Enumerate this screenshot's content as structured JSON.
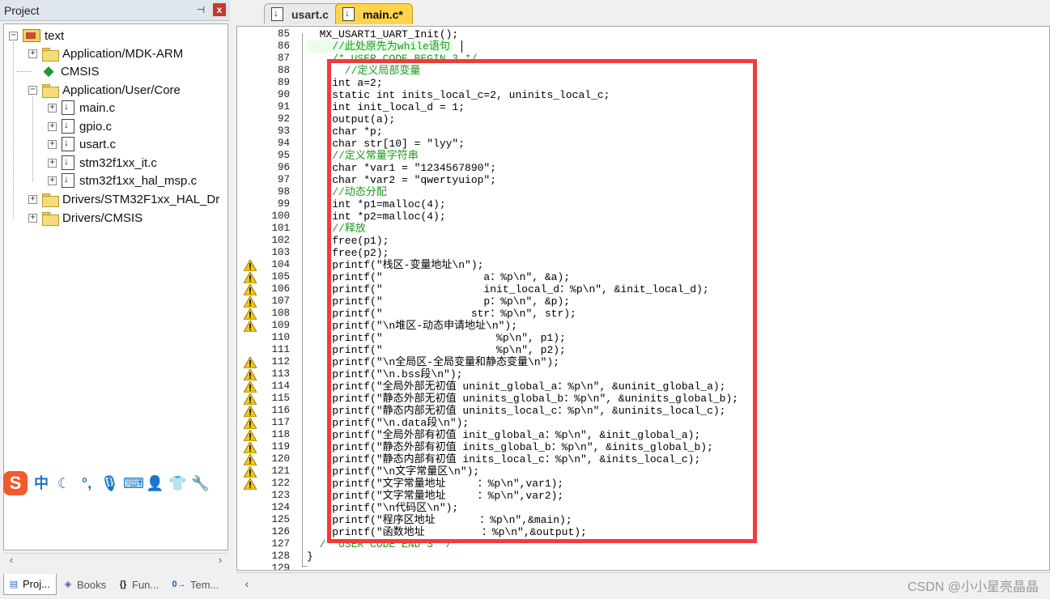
{
  "project_panel": {
    "title": "Project",
    "pin_glyph": "⊣",
    "close_glyph": "x",
    "tree": [
      {
        "label": "text",
        "level": 0,
        "icon": "project-root-icon",
        "expander": "−"
      },
      {
        "label": "Application/MDK-ARM",
        "level": 1,
        "icon": "folder-icon",
        "expander": "+"
      },
      {
        "label": "CMSIS",
        "level": 1,
        "icon": "cmsis-diamond-icon",
        "expander": ""
      },
      {
        "label": "Application/User/Core",
        "level": 1,
        "icon": "folder-icon",
        "expander": "−"
      },
      {
        "label": "main.c",
        "level": 2,
        "icon": "file-icon",
        "expander": "+"
      },
      {
        "label": "gpio.c",
        "level": 2,
        "icon": "file-icon",
        "expander": "+"
      },
      {
        "label": "usart.c",
        "level": 2,
        "icon": "file-icon",
        "expander": "+"
      },
      {
        "label": "stm32f1xx_it.c",
        "level": 2,
        "icon": "file-icon",
        "expander": "+"
      },
      {
        "label": "stm32f1xx_hal_msp.c",
        "level": 2,
        "icon": "file-icon",
        "expander": "+"
      },
      {
        "label": "Drivers/STM32F1xx_HAL_Dr",
        "level": 1,
        "icon": "folder-icon",
        "expander": "+"
      },
      {
        "label": "Drivers/CMSIS",
        "level": 1,
        "icon": "folder-icon",
        "expander": "+"
      }
    ],
    "ime_toolbar": {
      "logo": "S",
      "buttons": [
        "中",
        "☾",
        "°,",
        "🎙",
        "⌨",
        "👤",
        "👕",
        "🔧"
      ]
    },
    "bottom_tabs": [
      {
        "label": "Proj...",
        "icon": "project-tab-icon"
      },
      {
        "label": "Books",
        "icon": "books-tab-icon"
      },
      {
        "label": "Fun...",
        "icon": "functions-tab-icon"
      },
      {
        "label": "Tem...",
        "icon": "templates-tab-icon"
      }
    ],
    "icons": {
      "project_tab": "▤",
      "books_tab": "◈",
      "functions_tab": "{}",
      "templates_tab": "0→"
    }
  },
  "editor": {
    "tabs": [
      {
        "label": "usart.c",
        "active": false
      },
      {
        "label": "main.c*",
        "active": true
      }
    ],
    "colors": {
      "active_tab": "#ffd44a",
      "comment": "#1a9a1a",
      "highlight_box": "#f23b3b",
      "warning": "#f2c618"
    },
    "lines": [
      {
        "n": "85",
        "text": "  MX_USART1_UART_Init();",
        "type": "code",
        "warn": false
      },
      {
        "n": "86",
        "text": "    //此处原先为while语句",
        "type": "cmt",
        "warn": false
      },
      {
        "n": "87",
        "text": "    /* USER CODE BEGIN 3 */",
        "type": "cmt",
        "warn": false
      },
      {
        "n": "88",
        "text": "      //定义局部变量",
        "type": "cmt",
        "warn": false
      },
      {
        "n": "89",
        "text": "    int a=2;",
        "type": "code",
        "warn": false
      },
      {
        "n": "90",
        "text": "    static int inits_local_c=2, uninits_local_c;",
        "type": "code",
        "warn": false
      },
      {
        "n": "91",
        "text": "    int init_local_d = 1;",
        "type": "code",
        "warn": false
      },
      {
        "n": "92",
        "text": "    output(a);",
        "type": "code",
        "warn": false
      },
      {
        "n": "93",
        "text": "    char *p;",
        "type": "code",
        "warn": false
      },
      {
        "n": "94",
        "text": "    char str[10] = \"lyy\";",
        "type": "code",
        "warn": false
      },
      {
        "n": "95",
        "text": "    //定义常量字符串",
        "type": "cmt",
        "warn": false
      },
      {
        "n": "96",
        "text": "    char *var1 = \"1234567890\";",
        "type": "code",
        "warn": false
      },
      {
        "n": "97",
        "text": "    char *var2 = \"qwertyuiop\";",
        "type": "code",
        "warn": false
      },
      {
        "n": "98",
        "text": "    //动态分配",
        "type": "cmt",
        "warn": false
      },
      {
        "n": "99",
        "text": "    int *p1=malloc(4);",
        "type": "code",
        "warn": false
      },
      {
        "n": "100",
        "text": "    int *p2=malloc(4);",
        "type": "code",
        "warn": false
      },
      {
        "n": "101",
        "text": "    //释放",
        "type": "cmt",
        "warn": false
      },
      {
        "n": "102",
        "text": "    free(p1);",
        "type": "code",
        "warn": false
      },
      {
        "n": "103",
        "text": "    free(p2);",
        "type": "code",
        "warn": false
      },
      {
        "n": "104",
        "text": "    printf(\"栈区-变量地址\\n\");",
        "type": "code",
        "warn": true
      },
      {
        "n": "105",
        "text": "    printf(\"                a：%p\\n\", &a);",
        "type": "code",
        "warn": true
      },
      {
        "n": "106",
        "text": "    printf(\"                init_local_d：%p\\n\", &init_local_d);",
        "type": "code",
        "warn": true
      },
      {
        "n": "107",
        "text": "    printf(\"                p：%p\\n\", &p);",
        "type": "code",
        "warn": true
      },
      {
        "n": "108",
        "text": "    printf(\"              str：%p\\n\", str);",
        "type": "code",
        "warn": true
      },
      {
        "n": "109",
        "text": "    printf(\"\\n堆区-动态申请地址\\n\");",
        "type": "code",
        "warn": true
      },
      {
        "n": "110",
        "text": "    printf(\"                  %p\\n\", p1);",
        "type": "code",
        "warn": false
      },
      {
        "n": "111",
        "text": "    printf(\"                  %p\\n\", p2);",
        "type": "code",
        "warn": false
      },
      {
        "n": "112",
        "text": "    printf(\"\\n全局区-全局变量和静态变量\\n\");",
        "type": "code",
        "warn": true
      },
      {
        "n": "113",
        "text": "    printf(\"\\n.bss段\\n\");",
        "type": "code",
        "warn": true
      },
      {
        "n": "114",
        "text": "    printf(\"全局外部无初值 uninit_global_a：%p\\n\", &uninit_global_a);",
        "type": "code",
        "warn": true
      },
      {
        "n": "115",
        "text": "    printf(\"静态外部无初值 uninits_global_b：%p\\n\", &uninits_global_b);",
        "type": "code",
        "warn": true
      },
      {
        "n": "116",
        "text": "    printf(\"静态内部无初值 uninits_local_c：%p\\n\", &uninits_local_c);",
        "type": "code",
        "warn": true
      },
      {
        "n": "117",
        "text": "    printf(\"\\n.data段\\n\");",
        "type": "code",
        "warn": true
      },
      {
        "n": "118",
        "text": "    printf(\"全局外部有初值 init_global_a：%p\\n\", &init_global_a);",
        "type": "code",
        "warn": true
      },
      {
        "n": "119",
        "text": "    printf(\"静态外部有初值 inits_global_b：%p\\n\", &inits_global_b);",
        "type": "code",
        "warn": true
      },
      {
        "n": "120",
        "text": "    printf(\"静态内部有初值 inits_local_c：%p\\n\", &inits_local_c);",
        "type": "code",
        "warn": true
      },
      {
        "n": "121",
        "text": "    printf(\"\\n文字常量区\\n\");",
        "type": "code",
        "warn": true
      },
      {
        "n": "122",
        "text": "    printf(\"文字常量地址     ：%p\\n\",var1);",
        "type": "code",
        "warn": true
      },
      {
        "n": "123",
        "text": "    printf(\"文字常量地址     ：%p\\n\",var2);",
        "type": "code",
        "warn": false
      },
      {
        "n": "124",
        "text": "    printf(\"\\n代码区\\n\");",
        "type": "code",
        "warn": false
      },
      {
        "n": "125",
        "text": "    printf(\"程序区地址       ：%p\\n\",&main);",
        "type": "code",
        "warn": false
      },
      {
        "n": "126",
        "text": "    printf(\"函数地址         ：%p\\n\",&output);",
        "type": "code",
        "warn": false
      },
      {
        "n": "127",
        "text": "  /* USER CODE END 3 */",
        "type": "cmt",
        "warn": false
      },
      {
        "n": "128",
        "text": "}",
        "type": "code",
        "warn": false
      },
      {
        "n": "129",
        "text": "",
        "type": "code",
        "warn": false
      }
    ]
  },
  "watermark": "CSDN @小小星亮晶晶"
}
